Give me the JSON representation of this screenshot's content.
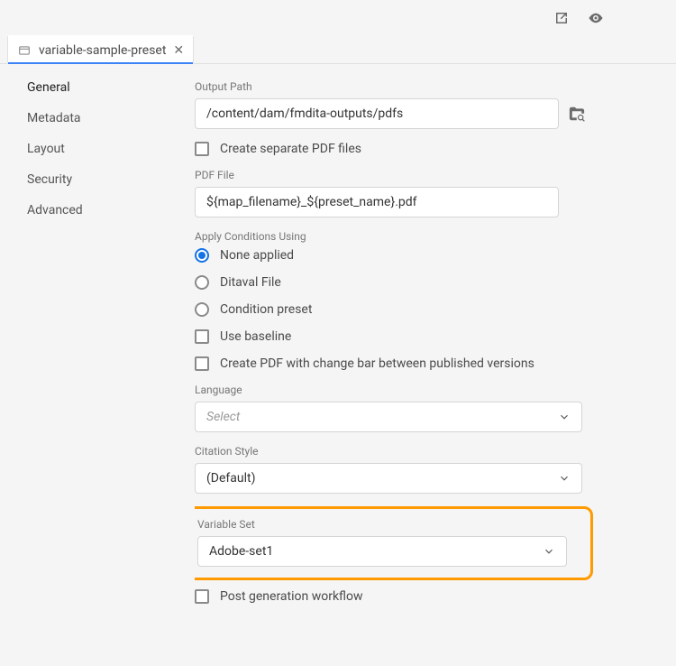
{
  "topbar": {
    "export_icon": "export-icon",
    "eye_icon": "preview-icon"
  },
  "tab": {
    "title": "variable-sample-preset"
  },
  "sidebar": {
    "items": [
      {
        "label": "General",
        "active": true
      },
      {
        "label": "Metadata",
        "active": false
      },
      {
        "label": "Layout",
        "active": false
      },
      {
        "label": "Security",
        "active": false
      },
      {
        "label": "Advanced",
        "active": false
      }
    ]
  },
  "form": {
    "output_path_label": "Output Path",
    "output_path_value": "/content/dam/fmdita-outputs/pdfs",
    "create_separate_label": "Create separate PDF files",
    "pdf_file_label": "PDF File",
    "pdf_file_value": "${map_filename}_${preset_name}.pdf",
    "apply_conditions_label": "Apply Conditions Using",
    "conditions": {
      "none": "None applied",
      "ditaval": "Ditaval File",
      "preset": "Condition preset"
    },
    "use_baseline_label": "Use baseline",
    "change_bar_label": "Create PDF with change bar between published versions",
    "language_label": "Language",
    "language_placeholder": "Select",
    "citation_label": "Citation Style",
    "citation_value": "(Default)",
    "variable_set_label": "Variable Set",
    "variable_set_value": "Adobe-set1",
    "post_gen_label": "Post generation workflow"
  }
}
